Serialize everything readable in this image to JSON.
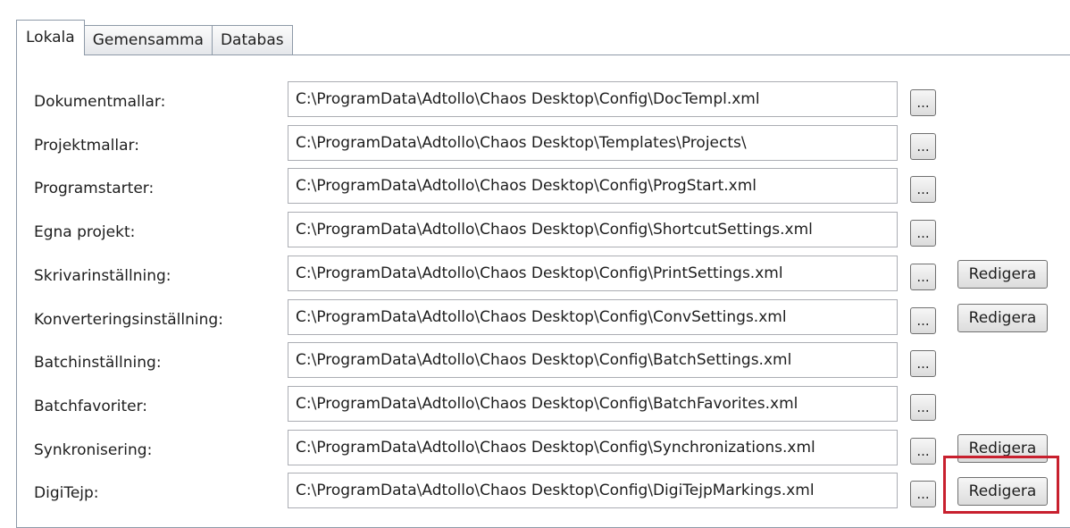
{
  "tabs": [
    {
      "label": "Lokala",
      "active": true
    },
    {
      "label": "Gemensamma",
      "active": false
    },
    {
      "label": "Databas",
      "active": false
    }
  ],
  "browse_label": "...",
  "rows": [
    {
      "label": "Dokumentmallar:",
      "value": "C:\\ProgramData\\Adtollo\\Chaos Desktop\\Config\\DocTempl.xml",
      "edit": ""
    },
    {
      "label": "Projektmallar:",
      "value": "C:\\ProgramData\\Adtollo\\Chaos Desktop\\Templates\\Projects\\",
      "edit": ""
    },
    {
      "label": "Programstarter:",
      "value": "C:\\ProgramData\\Adtollo\\Chaos Desktop\\Config\\ProgStart.xml",
      "edit": ""
    },
    {
      "label": "Egna projekt:",
      "value": "C:\\ProgramData\\Adtollo\\Chaos Desktop\\Config\\ShortcutSettings.xml",
      "edit": ""
    },
    {
      "label": "Skrivarinställning:",
      "value": "C:\\ProgramData\\Adtollo\\Chaos Desktop\\Config\\PrintSettings.xml",
      "edit": "Redigera"
    },
    {
      "label": "Konverteringsinställning:",
      "value": "C:\\ProgramData\\Adtollo\\Chaos Desktop\\Config\\ConvSettings.xml",
      "edit": "Redigera"
    },
    {
      "label": "Batchinställning:",
      "value": "C:\\ProgramData\\Adtollo\\Chaos Desktop\\Config\\BatchSettings.xml",
      "edit": ""
    },
    {
      "label": "Batchfavoriter:",
      "value": "C:\\ProgramData\\Adtollo\\Chaos Desktop\\Config\\BatchFavorites.xml",
      "edit": ""
    },
    {
      "label": "Synkronisering:",
      "value": "C:\\ProgramData\\Adtollo\\Chaos Desktop\\Config\\Synchronizations.xml",
      "edit": "Redigera"
    },
    {
      "label": "DigiTejp:",
      "value": "C:\\ProgramData\\Adtollo\\Chaos Desktop\\Config\\DigiTejpMarkings.xml",
      "edit": "Redigera"
    }
  ],
  "colors": {
    "highlight": "#c8202e",
    "tab_border": "#8e9aa8",
    "input_border": "#abadb3"
  }
}
